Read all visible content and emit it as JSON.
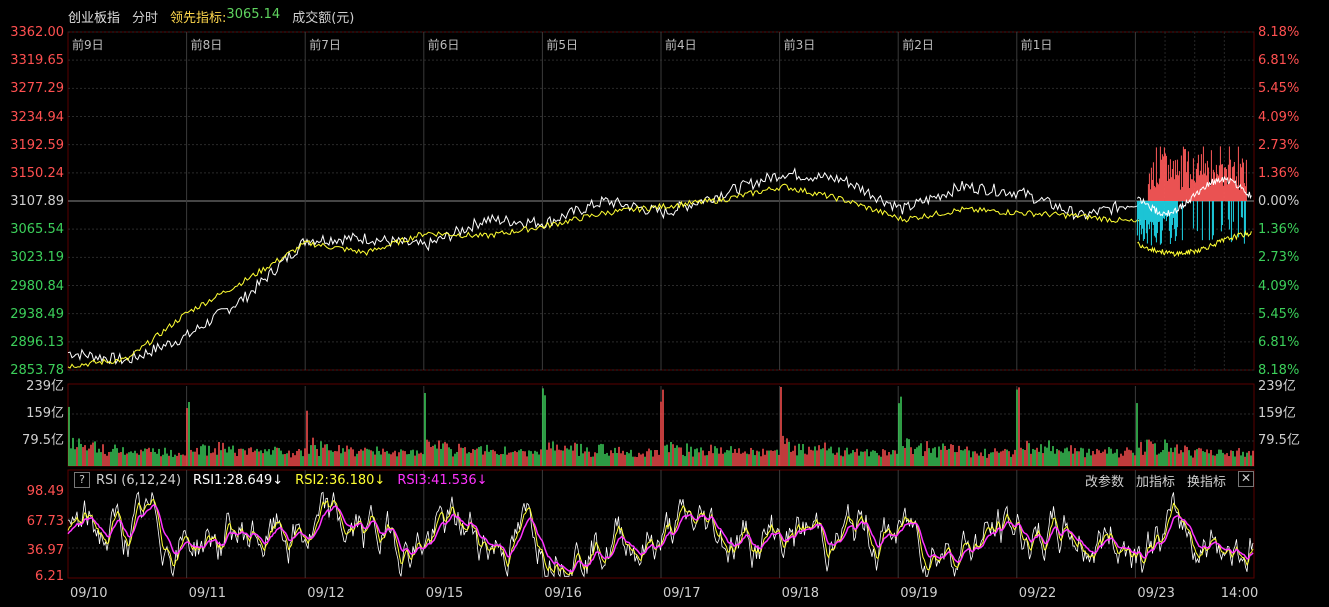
{
  "header": {
    "title": "创业板指",
    "mode": "分时",
    "lead_label": "领先指标:",
    "lead_value": "3065.14",
    "volume_label": "成交额(元)"
  },
  "price_axis": {
    "left": [
      "3362.00",
      "3319.65",
      "3277.29",
      "3234.94",
      "3192.59",
      "3150.24",
      "3107.89",
      "3065.54",
      "3023.19",
      "2980.84",
      "2938.49",
      "2896.13",
      "2853.78"
    ],
    "right": [
      "8.18%",
      "6.81%",
      "5.45%",
      "4.09%",
      "2.73%",
      "1.36%",
      "0.00%",
      "1.36%",
      "2.73%",
      "4.09%",
      "5.45%",
      "6.81%",
      "8.18%"
    ]
  },
  "day_labels": [
    "前9日",
    "前8日",
    "前7日",
    "前6日",
    "前5日",
    "前4日",
    "前3日",
    "前2日",
    "前1日"
  ],
  "volume_axis": {
    "labels": [
      "239亿",
      "159亿",
      "79.5亿"
    ]
  },
  "rsi": {
    "help": "?",
    "name": "RSI (6,12,24)",
    "rsi1": "RSI1:28.649↓",
    "rsi2": "RSI2:36.180↓",
    "rsi3": "RSI3:41.536↓",
    "axis": [
      "98.49",
      "67.73",
      "36.97",
      "6.21"
    ],
    "tools": {
      "params": "改参数",
      "add": "加指标",
      "switch": "换指标",
      "close": "✕"
    }
  },
  "dates": [
    "09/10",
    "09/11",
    "09/12",
    "09/15",
    "09/16",
    "09/17",
    "09/18",
    "09/19",
    "09/22",
    "09/23",
    "14:00"
  ],
  "colors": {
    "up": "#ff5050",
    "down": "#3ccf5a",
    "price": "#ffffff",
    "lead": "#ffff33",
    "rsi3": "#ff33ff",
    "grid": "#3a0000"
  },
  "chart_data": {
    "type": "line",
    "title": "创业板指",
    "ylim": [
      2853.78,
      3362.0
    ],
    "series": [
      {
        "name": "价格",
        "values": [
          2880,
          2868,
          2905,
          2965,
          3050,
          3052,
          3040,
          3080,
          3075,
          3108,
          3090,
          3120,
          3150,
          3140,
          3095,
          3130,
          3120,
          3085,
          3108,
          3140,
          3115,
          3070
        ]
      },
      {
        "name": "领先指标",
        "values": [
          2860,
          2870,
          2940,
          2990,
          3045,
          3030,
          3060,
          3055,
          3070,
          3090,
          3100,
          3110,
          3130,
          3110,
          3080,
          3095,
          3090,
          3085,
          3075,
          3100,
          3040,
          3065.14
        ]
      }
    ]
  }
}
